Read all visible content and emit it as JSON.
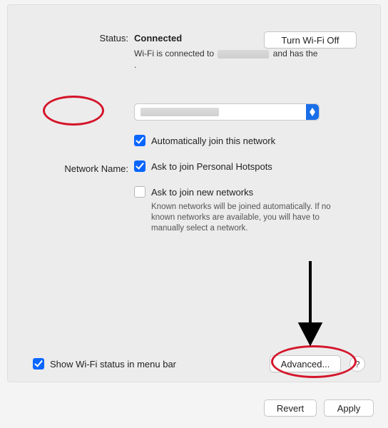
{
  "status": {
    "label": "Status:",
    "value": "Connected",
    "desc_prefix": "Wi-Fi is connected to",
    "desc_suffix": "and has the",
    "desc_end": "."
  },
  "turn_off_btn": "Turn Wi-Fi Off",
  "network_name_label": "Network Name:",
  "checks": {
    "auto_join": "Automatically join this network",
    "hotspots": "Ask to join Personal Hotspots",
    "new_networks": "Ask to join new networks",
    "new_networks_help": "Known networks will be joined automatically. If no known networks are available, you will have to manually select a network."
  },
  "show_status": "Show Wi-Fi status in menu bar",
  "advanced_btn": "Advanced...",
  "help_btn": "?",
  "revert_btn": "Revert",
  "apply_btn": "Apply"
}
